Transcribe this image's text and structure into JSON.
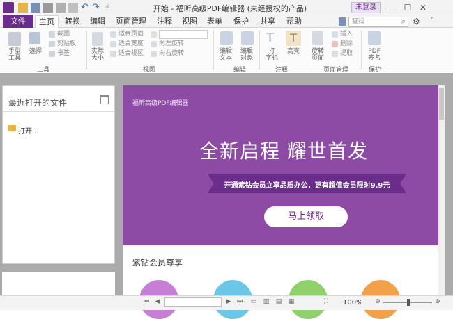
{
  "window": {
    "title": "开始 - 福昕高级PDF编辑器 (未经授权的产品)",
    "login_label": "未登录",
    "min": "—",
    "max": "☐",
    "close": "✕"
  },
  "menu": {
    "file": "文件",
    "tabs": [
      "主页",
      "转换",
      "编辑",
      "页面管理",
      "注释",
      "视图",
      "表单",
      "保护",
      "共享",
      "帮助"
    ],
    "search_placeholder": "查找"
  },
  "ribbon": {
    "hand_tool": "手型\n工具",
    "select": "选择",
    "screenshot": "截图",
    "clipboard": "剪贴板",
    "bookmark": "书签",
    "actual_size": "实际\n大小",
    "fit_page": "适合页面",
    "fit_width": "适合宽度",
    "fit_visible": "适合视区",
    "rotate_left": "向左旋转",
    "rotate_right": "向右旋转",
    "edit_text": "编辑\n文本",
    "edit_object": "编辑\n对象",
    "typewriter": "打\n字机",
    "highlight": "高亮",
    "rotate_page": "旋转\n页面",
    "insert": "插入",
    "delete": "删除",
    "extract": "提取",
    "pdf_sign": "PDF\n签名",
    "groups": {
      "tools": "工具",
      "view": "视图",
      "edit": "编辑",
      "annotate": "注释",
      "page_manage": "页面管理",
      "protect": "保护"
    }
  },
  "left_panel": {
    "title": "最近打开的文件",
    "open_item": "打开..."
  },
  "banner": {
    "brand": "福昕高级PDF编辑器",
    "headline": "全新启程 耀世首发",
    "promo": "开通紫钻会员立享品质办公，更有超值会员限时9.9元",
    "button": "马上领取"
  },
  "member": {
    "title": "紫钻会员尊享"
  },
  "status": {
    "zoom": "100%"
  },
  "colors": {
    "brand": "#6b2d8c",
    "banner": "#8e4ba6"
  }
}
